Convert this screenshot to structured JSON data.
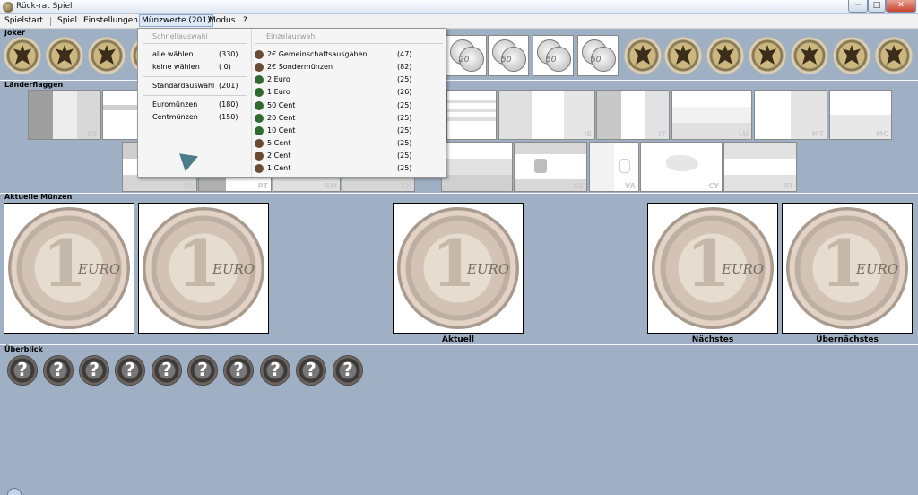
{
  "window": {
    "title": "Rück-rat Spiel",
    "min": "─",
    "max": "□",
    "close": "✕"
  },
  "menu": {
    "items": [
      "Spielstart",
      "Spiel",
      "Einstellungen",
      "Münzwerte (201)",
      "Modus",
      "?"
    ]
  },
  "sections": {
    "joker": "Joker",
    "flags": "Länderflaggen",
    "current": "Aktuelle Münzen",
    "overview": "Überblick"
  },
  "joker_tiles": [
    "20",
    "50",
    "50",
    "50"
  ],
  "flags": [
    "BE",
    "MC",
    "IE",
    "IT",
    "LU",
    "MT",
    "NL",
    "PT",
    "SM",
    "SK",
    "SI",
    "ES",
    "VA",
    "CY",
    "AT"
  ],
  "current_captions": {
    "current": "Aktuell",
    "next": "Nächstes",
    "after_next": "Übernächstes"
  },
  "coin_labels": {
    "one": "1",
    "euro": "EURO"
  },
  "overview_symbol": "?",
  "dropdown": {
    "quick_header": "Schnellauswahl",
    "single_header": "Einzelauswahl",
    "quick": [
      {
        "label": "alle wählen",
        "count": "(330)"
      },
      {
        "label": "keine wählen",
        "count": "(   0)"
      },
      {
        "label": "Standardauswahl",
        "count": "(201)"
      },
      {
        "label": "Euromünzen",
        "count": "(180)"
      },
      {
        "label": "Centmünzen",
        "count": "(150)"
      }
    ],
    "single": [
      {
        "label": "2€ Gemeinschaftsausgaben",
        "count": "(47)"
      },
      {
        "label": "2€ Sondermünzen",
        "count": "(82)"
      },
      {
        "label": "2 Euro",
        "count": "(25)"
      },
      {
        "label": "1 Euro",
        "count": "(26)"
      },
      {
        "label": "50 Cent",
        "count": "(25)"
      },
      {
        "label": "20 Cent",
        "count": "(25)"
      },
      {
        "label": "10 Cent",
        "count": "(25)"
      },
      {
        "label": "5 Cent",
        "count": "(25)"
      },
      {
        "label": "2 Cent",
        "count": "(25)"
      },
      {
        "label": "1 Cent",
        "count": "(25)"
      }
    ]
  },
  "colors": {
    "background": "#9fb0c4",
    "menu_highlight": "#dce8f5",
    "check_green": "#2f6b2f",
    "special_brown": "#6b4a32"
  }
}
